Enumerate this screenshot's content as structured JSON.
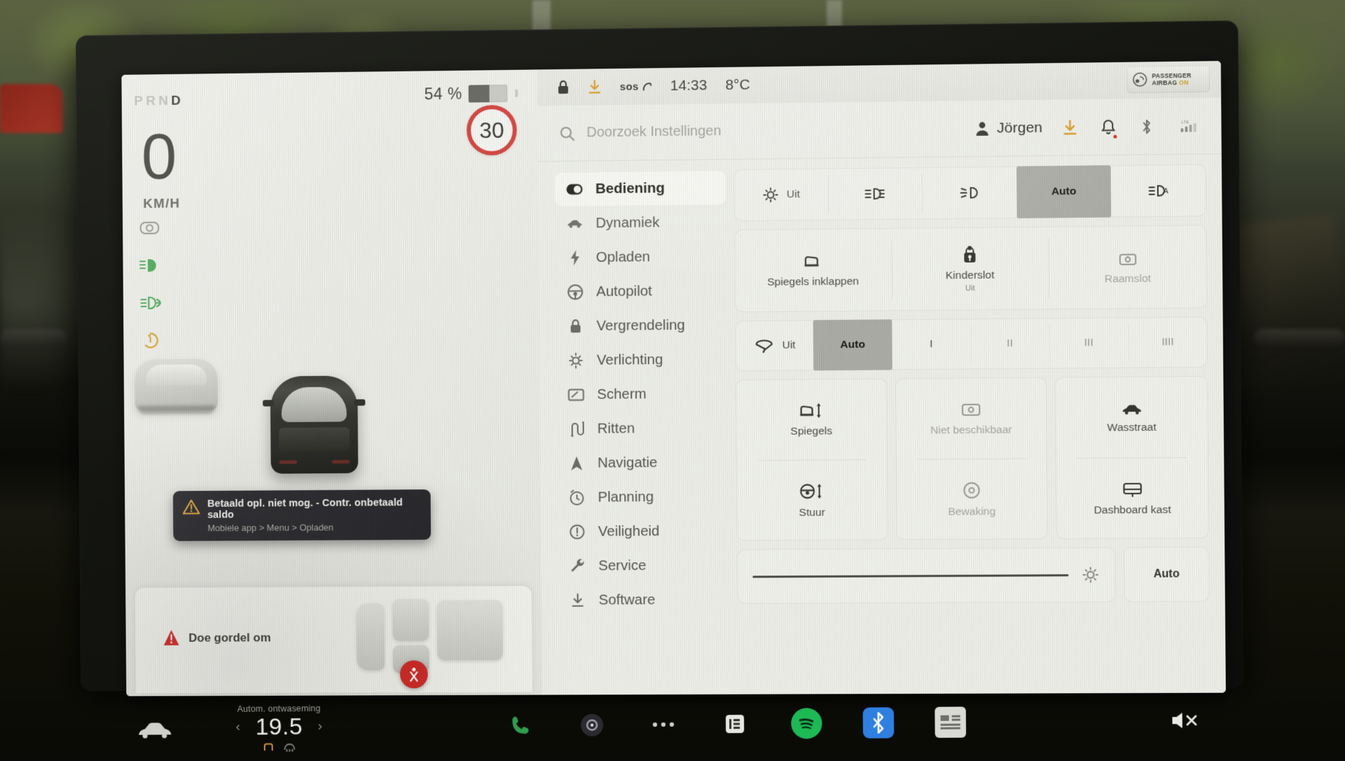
{
  "vehicle_display": {
    "gear_indicator": {
      "letters": [
        "P",
        "R",
        "N",
        "D"
      ],
      "active": "D"
    },
    "battery": {
      "percent_label": "54 %",
      "fill_percent": 54
    },
    "speed": {
      "value": "0",
      "unit": "KM/H"
    },
    "speed_limit": {
      "value": "30"
    },
    "telltales": [
      {
        "name": "autopilot-camera-icon",
        "color": "#6f7169"
      },
      {
        "name": "low-beam-icon",
        "color": "#3fa14a"
      },
      {
        "name": "fog-light-icon",
        "color": "#3fa14a"
      },
      {
        "name": "regen-limited-icon",
        "color": "#d79b2a"
      },
      {
        "name": "seatbelt-warning-icon",
        "color": "#cf2a26"
      }
    ],
    "toast": {
      "title": "Betaald opl. niet mog. - Contr. onbetaald saldo",
      "subtitle": "Mobiele app > Menu > Opladen"
    },
    "seatbelt_card": {
      "message": "Doe gordel om"
    }
  },
  "status_bar": {
    "lock_icon": "lock-closed-icon",
    "download_icon": "software-download-icon",
    "sos_label": "sos",
    "time": "14:33",
    "temperature": "8°C",
    "airbag_indicator": {
      "line1": "PASSENGER",
      "line2": "AIRBAG",
      "state": "ON"
    }
  },
  "search": {
    "placeholder": "Doorzoek Instellingen",
    "icon": "search-icon"
  },
  "account": {
    "name": "Jörgen",
    "icon": "person-icon"
  },
  "toolbar_icons": [
    {
      "name": "software-update-icon",
      "badge": false
    },
    {
      "name": "notification-bell-icon",
      "badge": true
    },
    {
      "name": "bluetooth-icon",
      "badge": false
    },
    {
      "name": "cellular-signal-icon",
      "badge": false,
      "label": "LTE"
    }
  ],
  "sidebar": {
    "items": [
      {
        "label": "Bediening",
        "icon": "toggle-switch-icon",
        "active": true
      },
      {
        "label": "Dynamiek",
        "icon": "car-side-icon",
        "active": false
      },
      {
        "label": "Opladen",
        "icon": "bolt-icon",
        "active": false
      },
      {
        "label": "Autopilot",
        "icon": "steering-wheel-icon",
        "active": false
      },
      {
        "label": "Vergrendeling",
        "icon": "lock-icon",
        "active": false
      },
      {
        "label": "Verlichting",
        "icon": "light-bulb-icon",
        "active": false
      },
      {
        "label": "Scherm",
        "icon": "display-icon",
        "active": false
      },
      {
        "label": "Ritten",
        "icon": "trips-route-icon",
        "active": false
      },
      {
        "label": "Navigatie",
        "icon": "navigation-arrow-icon",
        "active": false
      },
      {
        "label": "Planning",
        "icon": "schedule-clock-icon",
        "active": false
      },
      {
        "label": "Veiligheid",
        "icon": "safety-alert-icon",
        "active": false
      },
      {
        "label": "Service",
        "icon": "wrench-icon",
        "active": false
      },
      {
        "label": "Software",
        "icon": "software-download-icon",
        "active": false
      }
    ]
  },
  "controls": {
    "headlights": {
      "options": [
        {
          "label": "Uit",
          "icon": "parking-light-icon",
          "selected": false
        },
        {
          "label": "",
          "icon": "low-beam-icon",
          "selected": false
        },
        {
          "label": "",
          "icon": "headlight-beam-icon",
          "selected": false
        },
        {
          "label": "Auto",
          "icon": "",
          "selected": true
        },
        {
          "label": "",
          "icon": "auto-high-beam-icon",
          "selected": false
        }
      ]
    },
    "lock_tiles": [
      {
        "label": "Spiegels inklappen",
        "sublabel": "",
        "icon": "mirror-fold-icon",
        "disabled": false
      },
      {
        "label": "Kinderslot",
        "sublabel": "Uit",
        "icon": "child-lock-icon",
        "disabled": false
      },
      {
        "label": "Raamslot",
        "sublabel": "",
        "icon": "window-lock-icon",
        "disabled": true
      }
    ],
    "wipers": {
      "options": [
        {
          "label": "Uit",
          "icon": "wiper-icon",
          "selected": false
        },
        {
          "label": "Auto",
          "icon": "",
          "selected": true
        },
        {
          "label": "I",
          "icon": "",
          "selected": false
        },
        {
          "label": "II",
          "icon": "",
          "selected": false
        },
        {
          "label": "III",
          "icon": "",
          "selected": false
        },
        {
          "label": "IIII",
          "icon": "",
          "selected": false
        }
      ]
    },
    "adjust_tiles": [
      {
        "label": "Spiegels",
        "icon": "mirror-adjust-icon",
        "disabled": false
      },
      {
        "label": "Stuur",
        "icon": "steering-adjust-icon",
        "disabled": false
      }
    ],
    "camera_tiles": [
      {
        "label": "Niet beschikbaar",
        "icon": "camera-unavailable-icon",
        "disabled": true
      },
      {
        "label": "Bewaking",
        "icon": "sentry-mode-icon",
        "disabled": true
      }
    ],
    "right_tiles": [
      {
        "label": "Wasstraat",
        "icon": "car-wash-icon",
        "disabled": false
      },
      {
        "label": "Dashboard kast",
        "icon": "glovebox-icon",
        "disabled": false
      }
    ],
    "brightness": {
      "value_percent": 82,
      "icon": "brightness-icon",
      "auto_label": "Auto"
    }
  },
  "taskbar": {
    "car_icon": "car-front-icon",
    "climate": {
      "defog_label": "Autom. ontwaseming",
      "temperature": "19.5",
      "left_arrow": "‹",
      "right_arrow": "›",
      "icons": [
        "seat-heater-icon",
        "defrost-icon"
      ]
    },
    "apps": [
      {
        "name": "phone-icon",
        "label": ""
      },
      {
        "name": "media-player-icon",
        "label": ""
      },
      {
        "name": "more-dots-icon",
        "label": ""
      },
      {
        "name": "info-icon",
        "label": ""
      },
      {
        "name": "spotify-icon",
        "label": ""
      },
      {
        "name": "bluetooth-app-icon",
        "label": ""
      },
      {
        "name": "dashcam-icon",
        "label": ""
      }
    ],
    "volume": {
      "icon": "volume-mute-icon"
    }
  }
}
